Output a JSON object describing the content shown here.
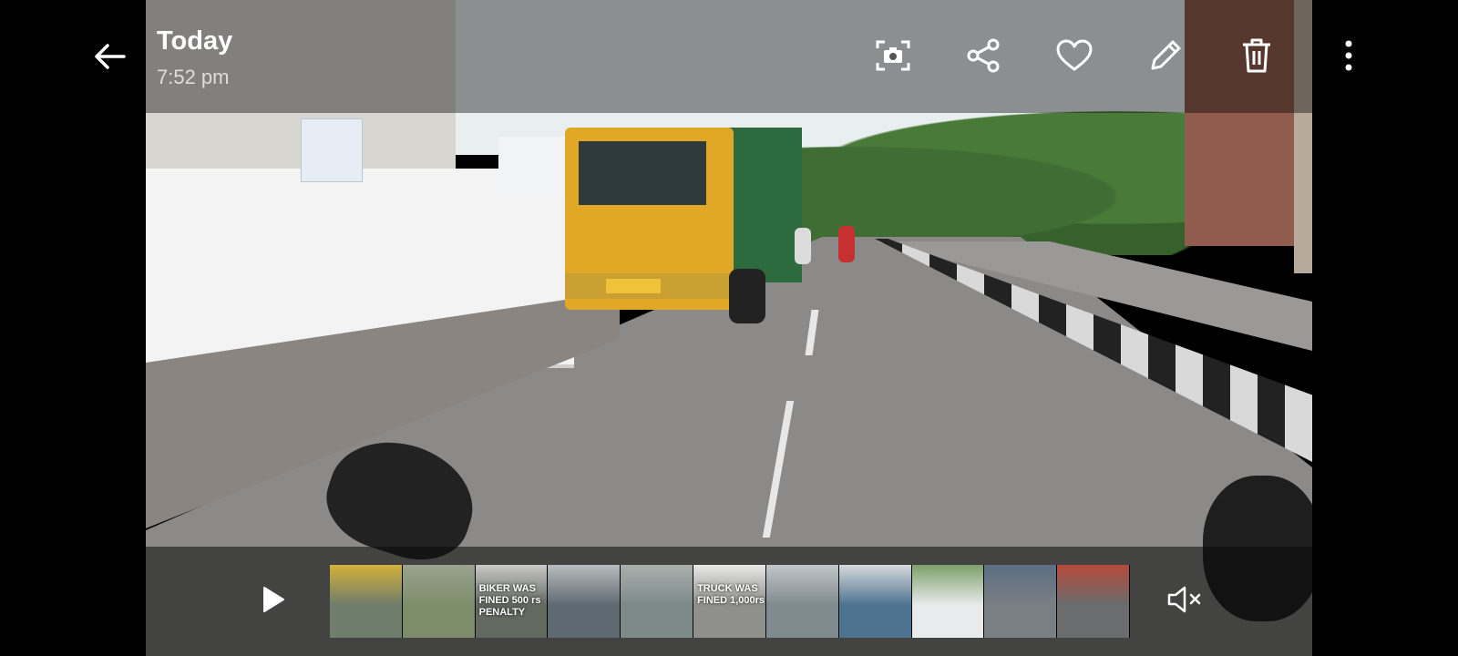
{
  "header": {
    "title": "Today",
    "subtitle": "7:52 pm",
    "back_icon": "arrow-left-icon",
    "actions": [
      {
        "id": "screenshot",
        "icon": "camera-capture-icon"
      },
      {
        "id": "share",
        "icon": "share-icon"
      },
      {
        "id": "favorite",
        "icon": "heart-icon"
      },
      {
        "id": "edit",
        "icon": "pencil-icon"
      },
      {
        "id": "delete",
        "icon": "trash-icon"
      },
      {
        "id": "more",
        "icon": "more-vertical-icon"
      }
    ]
  },
  "player": {
    "play_icon": "play-icon",
    "mute_icon": "volume-muted-icon",
    "thumbnails": [
      {
        "caption": "",
        "colors": [
          "#6f7d6b",
          "#d3b13a"
        ]
      },
      {
        "caption": "",
        "colors": [
          "#7d8d6a",
          "#9aa38f"
        ]
      },
      {
        "caption": "BIKER WAS FINED 500 rs PENALTY",
        "colors": [
          "#626a60",
          "#c9c9c9"
        ]
      },
      {
        "caption": "",
        "colors": [
          "#5e6a72",
          "#b8bcbe"
        ]
      },
      {
        "caption": "",
        "colors": [
          "#7e8a88",
          "#a9b0ae"
        ]
      },
      {
        "caption": "TRUCK WAS FINED 1,000rs",
        "colors": [
          "#8f8f8b",
          "#e8e8e6"
        ]
      },
      {
        "caption": "",
        "colors": [
          "#7f8a8f",
          "#c1c7ca"
        ]
      },
      {
        "caption": "",
        "colors": [
          "#4d7390",
          "#d6d9dc"
        ]
      },
      {
        "caption": "",
        "colors": [
          "#e8eaec",
          "#7da06a"
        ]
      },
      {
        "caption": "",
        "colors": [
          "#7a7f84",
          "#5b6e82"
        ]
      },
      {
        "caption": "",
        "colors": [
          "#6a6c6d",
          "#b54a3a"
        ]
      }
    ]
  }
}
